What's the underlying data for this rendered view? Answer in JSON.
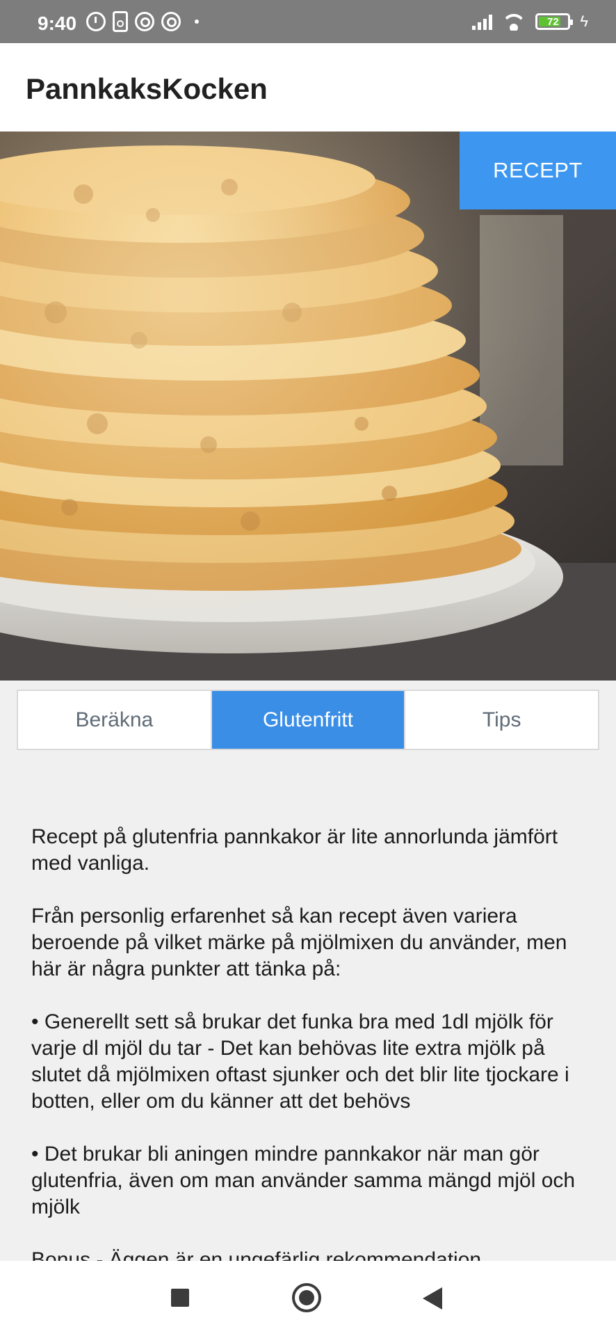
{
  "status_bar": {
    "time": "9:40",
    "battery_level": "72",
    "icons": [
      "alarm-icon",
      "speaker-icon",
      "sync-icon",
      "sync-icon",
      "dot-icon",
      "signal-icon",
      "wifi-icon",
      "battery-icon",
      "charging-icon"
    ]
  },
  "app_bar": {
    "title": "PannkaksKocken"
  },
  "hero": {
    "image": "pancake-stack-photo",
    "recept_button": "RECEPT"
  },
  "tabs": [
    {
      "label": "Beräkna",
      "active": false
    },
    {
      "label": "Glutenfritt",
      "active": true
    },
    {
      "label": "Tips",
      "active": false
    }
  ],
  "content": {
    "paragraphs": [
      "Recept på glutenfria pannkakor är lite annorlunda jämfört med vanliga.",
      "Från personlig erfarenhet så kan recept även variera beroende på vilket märke på mjölmixen du använder, men här är några punkter att tänka på:",
      "• Generellt sett så brukar det funka bra med 1dl mjölk för varje dl mjöl du tar - Det kan behövas lite extra mjölk på slutet då mjölmixen oftast sjunker och det blir lite tjockare i botten, eller om du känner att det behövs",
      "• Det brukar bli aningen mindre pannkakor när man gör glutenfria, även om man använder samma mängd mjöl och mjölk",
      "Bonus - Äggen är en ungefärlig rekommendation"
    ]
  },
  "nav_bar": {
    "buttons": [
      "recents-icon",
      "home-icon",
      "back-icon"
    ]
  },
  "colors": {
    "accent": "#3d97f0",
    "status_bar": "#7d7d7d",
    "background": "#f0f0f0"
  }
}
